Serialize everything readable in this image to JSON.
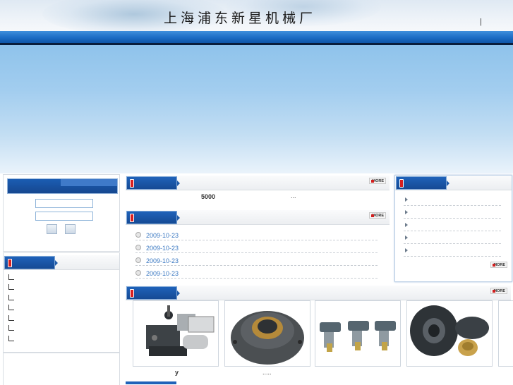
{
  "header": {
    "title": "上海浦东新星机械厂",
    "separator": "|"
  },
  "colors": {
    "nav_blue": "#1c6cc4",
    "tab_blue": "#1f62b9",
    "date_link": "#3a78c2",
    "flag_red": "#d82020"
  },
  "more_label": "MORE",
  "sidebar": {
    "login": {
      "username_value": "",
      "password_value": ""
    },
    "category_items": [
      "",
      "",
      "",
      "",
      "",
      "",
      ""
    ]
  },
  "main": {
    "intro": {
      "text_left": "5000",
      "text_right": "..."
    },
    "news": {
      "dates": [
        "2009-10-23",
        "2009-10-23",
        "2009-10-23",
        "2009-10-23"
      ]
    },
    "products": {
      "caption_left": "y",
      "caption_right": "....."
    }
  },
  "right_panel": {
    "items": [
      "",
      "",
      "",
      "",
      ""
    ]
  },
  "icons": {
    "flag": "flag-icon",
    "bullet": "circle-bullet-icon",
    "arrow": "triangle-arrow-icon",
    "tree": "tree-branch-icon"
  }
}
